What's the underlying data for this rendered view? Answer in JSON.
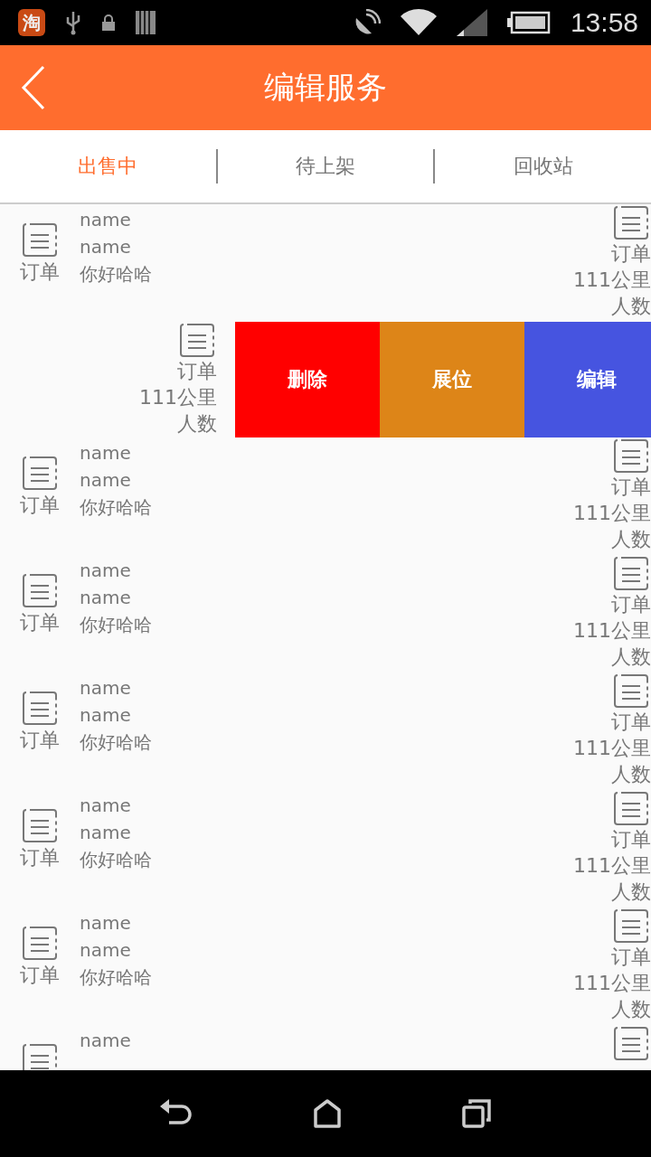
{
  "status_bar": {
    "app_badge": "淘",
    "time": "13:58"
  },
  "header": {
    "title": "编辑服务"
  },
  "tabs": [
    {
      "label": "出售中",
      "selected": true
    },
    {
      "label": "待上架",
      "selected": false
    },
    {
      "label": "回收站",
      "selected": false
    }
  ],
  "rows": [
    {
      "kind": "normal",
      "icon_label": "订单",
      "name_1": "name",
      "name_2": "name",
      "desc": "你好哈哈",
      "right_label": "订单",
      "distance": "111公里",
      "people": "人数"
    },
    {
      "kind": "swiped",
      "right_label": "订单",
      "distance": "111公里",
      "people": "人数",
      "actions": [
        {
          "label": "删除",
          "color": "#ff0000"
        },
        {
          "label": "展位",
          "color": "#dd8518"
        },
        {
          "label": "编辑",
          "color": "#4654e0"
        }
      ]
    },
    {
      "kind": "normal",
      "icon_label": "订单",
      "name_1": "name",
      "name_2": "name",
      "desc": "你好哈哈",
      "right_label": "订单",
      "distance": "111公里",
      "people": "人数"
    },
    {
      "kind": "normal",
      "icon_label": "订单",
      "name_1": "name",
      "name_2": "name",
      "desc": "你好哈哈",
      "right_label": "订单",
      "distance": "111公里",
      "people": "人数"
    },
    {
      "kind": "normal",
      "icon_label": "订单",
      "name_1": "name",
      "name_2": "name",
      "desc": "你好哈哈",
      "right_label": "订单",
      "distance": "111公里",
      "people": "人数"
    },
    {
      "kind": "normal",
      "icon_label": "订单",
      "name_1": "name",
      "name_2": "name",
      "desc": "你好哈哈",
      "right_label": "订单",
      "distance": "111公里",
      "people": "人数"
    },
    {
      "kind": "normal",
      "icon_label": "订单",
      "name_1": "name",
      "name_2": "name",
      "desc": "你好哈哈",
      "right_label": "订单",
      "distance": "111公里",
      "people": "人数"
    },
    {
      "kind": "normal",
      "name_1": "name"
    }
  ]
}
